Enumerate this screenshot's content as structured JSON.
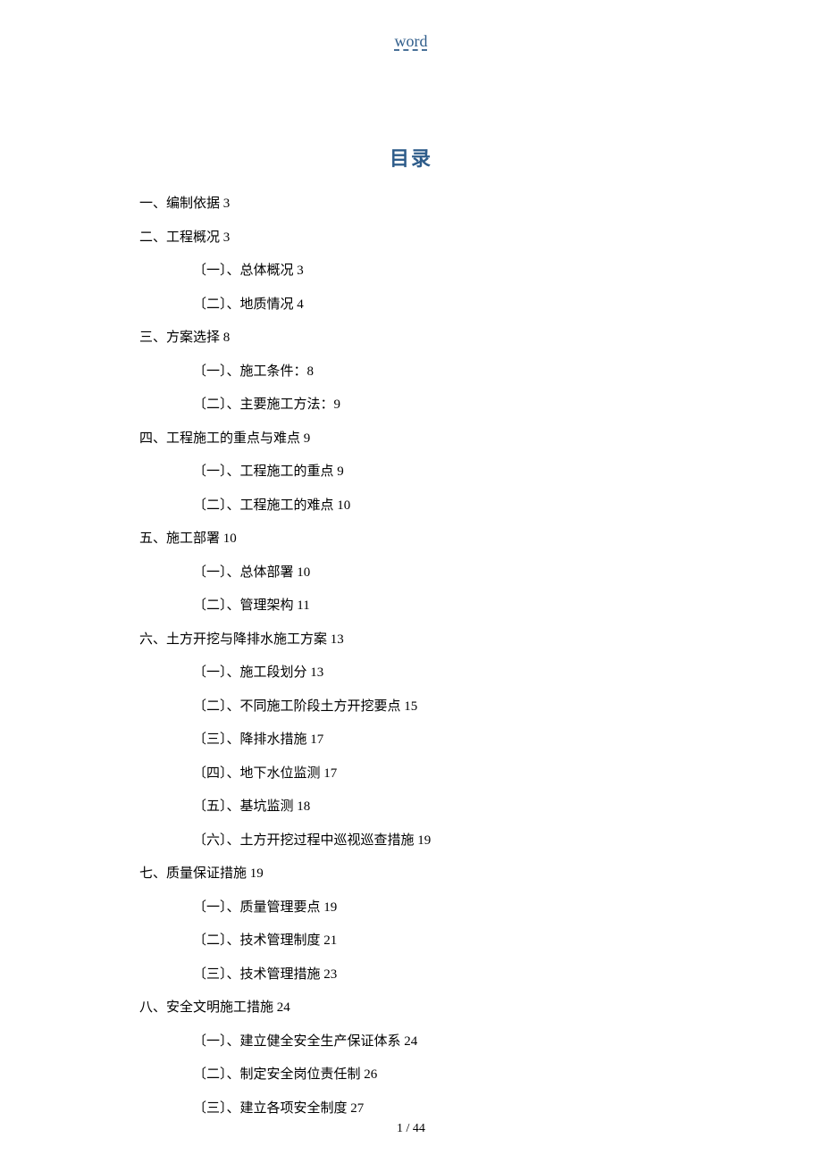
{
  "header": {
    "link_text": "word"
  },
  "toc": {
    "title": "目录",
    "items": [
      {
        "level": 1,
        "text": "一、编制依据 3"
      },
      {
        "level": 1,
        "text": "二、工程概况 3"
      },
      {
        "level": 2,
        "text": "〔一〕、总体概况 3"
      },
      {
        "level": 2,
        "text": "〔二〕、地质情况 4"
      },
      {
        "level": 1,
        "text": "三、方案选择 8"
      },
      {
        "level": 2,
        "text": "〔一〕、施工条件：8"
      },
      {
        "level": 2,
        "text": "〔二〕、主要施工方法：9"
      },
      {
        "level": 1,
        "text": "四、工程施工的重点与难点 9"
      },
      {
        "level": 2,
        "text": "〔一〕、工程施工的重点 9"
      },
      {
        "level": 2,
        "text": "〔二〕、工程施工的难点 10"
      },
      {
        "level": 1,
        "text": "五、施工部署 10"
      },
      {
        "level": 2,
        "text": "〔一〕、总体部署 10"
      },
      {
        "level": 2,
        "text": "〔二〕、管理架构 11"
      },
      {
        "level": 1,
        "text": "六、土方开挖与降排水施工方案 13"
      },
      {
        "level": 2,
        "text": "〔一〕、施工段划分 13"
      },
      {
        "level": 2,
        "text": "〔二〕、不同施工阶段土方开挖要点 15"
      },
      {
        "level": 2,
        "text": "〔三〕、降排水措施 17"
      },
      {
        "level": 2,
        "text": "〔四〕、地下水位监测 17"
      },
      {
        "level": 2,
        "text": "〔五〕、基坑监测 18"
      },
      {
        "level": 2,
        "text": "〔六〕、土方开挖过程中巡视巡查措施 19"
      },
      {
        "level": 1,
        "text": "七、质量保证措施 19"
      },
      {
        "level": 2,
        "text": "〔一〕、质量管理要点 19"
      },
      {
        "level": 2,
        "text": "〔二〕、技术管理制度 21"
      },
      {
        "level": 2,
        "text": "〔三〕、技术管理措施 23"
      },
      {
        "level": 1,
        "text": "八、安全文明施工措施 24"
      },
      {
        "level": 2,
        "text": "〔一〕、建立健全安全生产保证体系 24"
      },
      {
        "level": 2,
        "text": "〔二〕、制定安全岗位责任制 26"
      },
      {
        "level": 2,
        "text": "〔三〕、建立各项安全制度 27"
      }
    ]
  },
  "footer": {
    "page_number": "1 / 44"
  }
}
